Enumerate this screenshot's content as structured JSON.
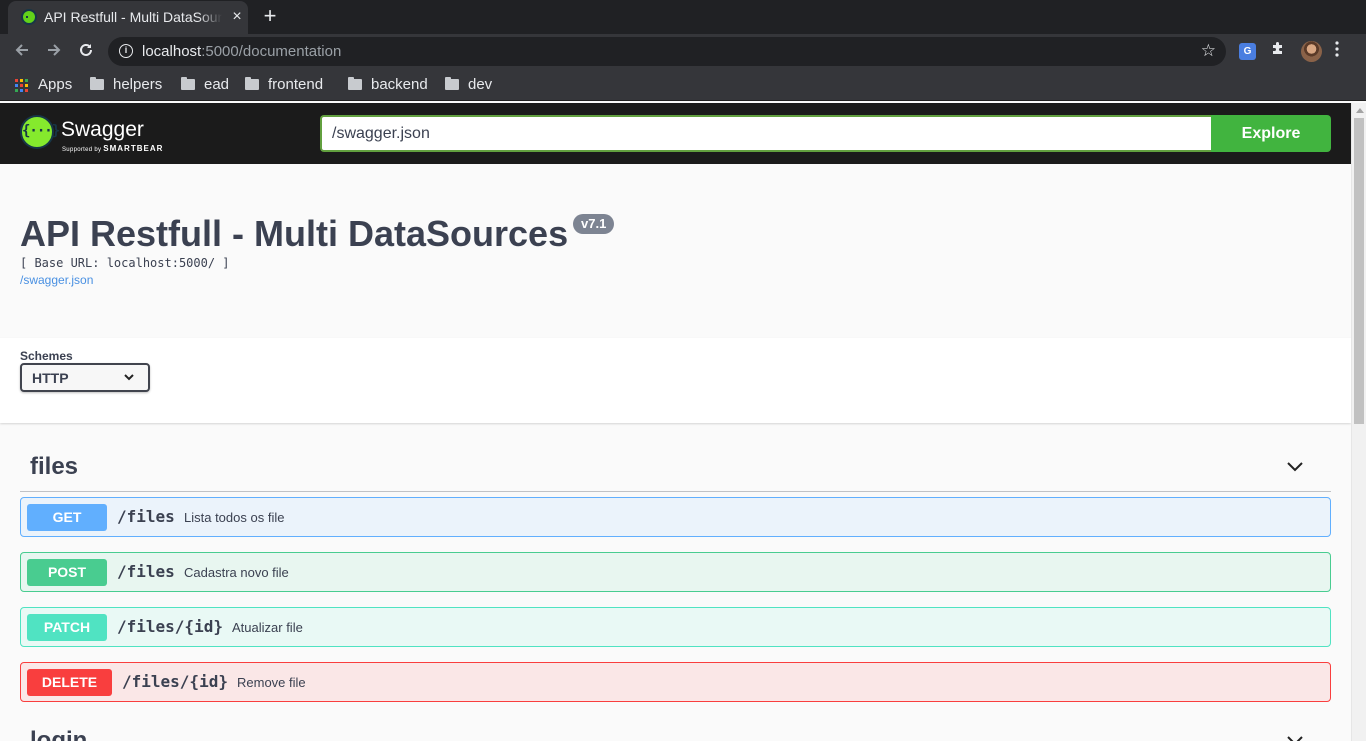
{
  "browser": {
    "tab_title": "API Restfull - Multi DataSources",
    "tab_close": "×",
    "new_tab": "+",
    "url_host": "localhost",
    "url_path": ":5000/documentation",
    "translate_icon_text": "G",
    "bookmarks": [
      {
        "label": "Apps",
        "icon": "apps-grid-icon"
      },
      {
        "label": "helpers",
        "icon": "folder-icon"
      },
      {
        "label": "ead",
        "icon": "folder-icon"
      },
      {
        "label": "frontend",
        "icon": "folder-icon"
      },
      {
        "label": "backend",
        "icon": "folder-icon"
      },
      {
        "label": "dev",
        "icon": "folder-icon"
      }
    ]
  },
  "swagger": {
    "logo_name": "Swagger",
    "logo_tagline": "Supported by",
    "logo_brand": "SMARTBEAR",
    "spec_url": "/swagger.json",
    "explore_label": "Explore",
    "colors": {
      "topbar": "#1b1b1b",
      "explore": "#41b43f",
      "get": "#61affe",
      "post": "#49cc90",
      "patch": "#50e3c2",
      "delete": "#f93e3e"
    }
  },
  "info": {
    "title": "API Restfull - Multi DataSources",
    "version": "v7.1",
    "base_url": "[ Base URL: localhost:5000/ ]",
    "spec_link": "/swagger.json"
  },
  "schemes": {
    "label": "Schemes",
    "selected": "HTTP"
  },
  "sections": [
    {
      "name": "files",
      "operations": [
        {
          "method": "GET",
          "path": "/files",
          "summary": "Lista todos os file"
        },
        {
          "method": "POST",
          "path": "/files",
          "summary": "Cadastra novo file"
        },
        {
          "method": "PATCH",
          "path": "/files/{id}",
          "summary": "Atualizar file"
        },
        {
          "method": "DELETE",
          "path": "/files/{id}",
          "summary": "Remove file"
        }
      ]
    },
    {
      "name": "login",
      "operations": []
    }
  ]
}
